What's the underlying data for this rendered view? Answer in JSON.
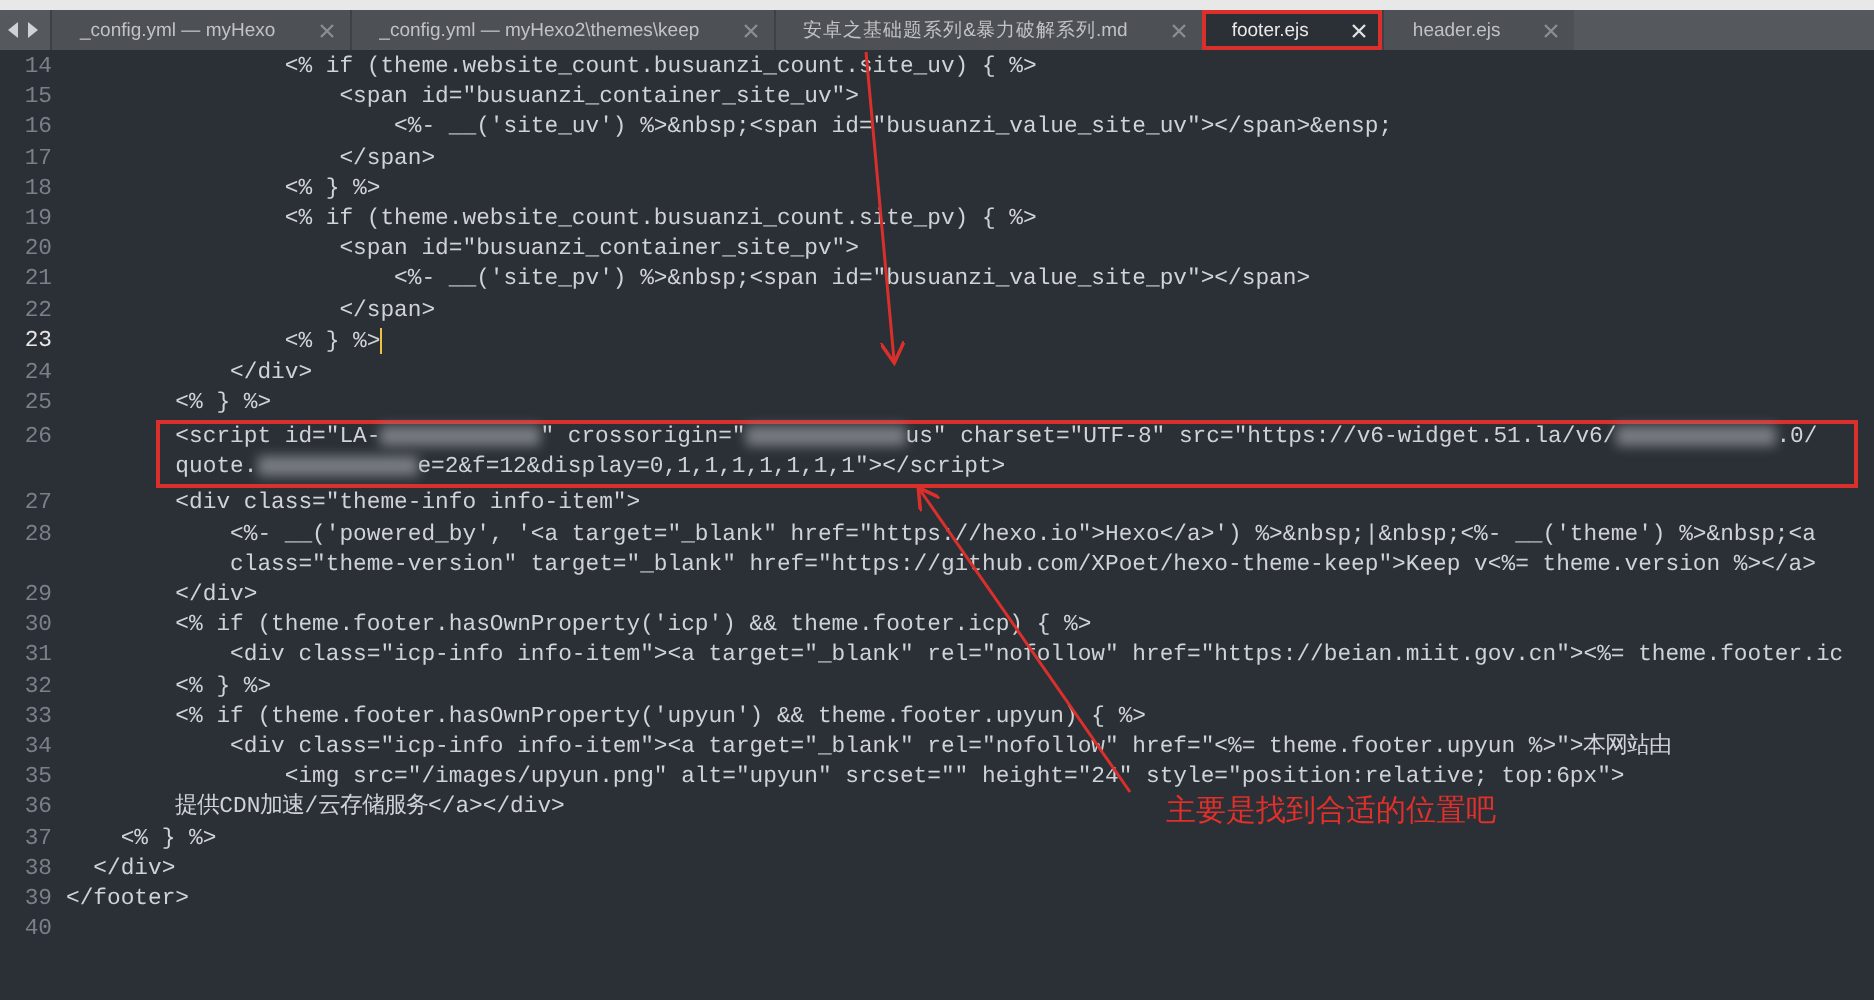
{
  "tabs": [
    {
      "label": "_config.yml — myHexo",
      "selected": false,
      "boxed": false
    },
    {
      "label": "_config.yml — myHexo2\\themes\\keep",
      "selected": false,
      "boxed": false
    },
    {
      "label": "安卓之基础题系列&暴力破解系列.md",
      "selected": false,
      "boxed": false
    },
    {
      "label": "footer.ejs",
      "selected": true,
      "boxed": true
    },
    {
      "label": "header.ejs",
      "selected": false,
      "boxed": false
    }
  ],
  "editor": {
    "lines": [
      {
        "number": "14",
        "current": false,
        "boxed": false,
        "rows": [
          "                <% if (theme.website_count.busuanzi_count.site_uv) { %>"
        ]
      },
      {
        "number": "15",
        "current": false,
        "boxed": false,
        "rows": [
          "                    <span id=\"busuanzi_container_site_uv\">"
        ]
      },
      {
        "number": "16",
        "current": false,
        "boxed": false,
        "rows": [
          "                        <%- __('site_uv') %>&nbsp;<span id=\"busuanzi_value_site_uv\"></span>&ensp;"
        ]
      },
      {
        "number": "17",
        "current": false,
        "boxed": false,
        "rows": [
          "                    </span>"
        ]
      },
      {
        "number": "18",
        "current": false,
        "boxed": false,
        "rows": [
          "                <% } %>"
        ]
      },
      {
        "number": "19",
        "current": false,
        "boxed": false,
        "rows": [
          "                <% if (theme.website_count.busuanzi_count.site_pv) { %>"
        ]
      },
      {
        "number": "20",
        "current": false,
        "boxed": false,
        "rows": [
          "                    <span id=\"busuanzi_container_site_pv\">"
        ]
      },
      {
        "number": "21",
        "current": false,
        "boxed": false,
        "rows": [
          "                        <%- __('site_pv') %>&nbsp;<span id=\"busuanzi_value_site_pv\"></span>"
        ]
      },
      {
        "number": "22",
        "current": false,
        "boxed": false,
        "rows": [
          "                    </span>"
        ]
      },
      {
        "number": "23",
        "current": true,
        "boxed": false,
        "rows": [
          "                <% } %>"
        ]
      },
      {
        "number": "24",
        "current": false,
        "boxed": false,
        "rows": [
          "            </div>"
        ]
      },
      {
        "number": "25",
        "current": false,
        "boxed": false,
        "rows": [
          "        <% } %>"
        ]
      },
      {
        "number": "26",
        "current": false,
        "boxed": true,
        "rows": [
          [
            {
              "kind": "text",
              "text": "        <script id=\"LA-"
            },
            {
              "kind": "blur"
            },
            {
              "kind": "text",
              "text": "\" crossorigin=\""
            },
            {
              "kind": "blur"
            },
            {
              "kind": "text",
              "text": "us\" charset=\"UTF-8\" src=\"https://v6-widget.51.la/v6/"
            },
            {
              "kind": "blur"
            },
            {
              "kind": "text",
              "text": ".0/"
            }
          ],
          [
            {
              "kind": "text",
              "text": "        quote."
            },
            {
              "kind": "blur"
            },
            {
              "kind": "text",
              "text": "e=2&f=12&display=0,1,1,1,1,1,1,1\"></script>"
            }
          ]
        ]
      },
      {
        "number": "27",
        "current": false,
        "boxed": false,
        "rows": [
          "        <div class=\"theme-info info-item\">"
        ]
      },
      {
        "number": "28",
        "current": false,
        "boxed": false,
        "rows": [
          "            <%- __('powered_by', '<a target=\"_blank\" href=\"https://hexo.io\">Hexo</a>') %>&nbsp;|&nbsp;<%- __('theme') %>&nbsp;<a",
          "            class=\"theme-version\" target=\"_blank\" href=\"https://github.com/XPoet/hexo-theme-keep\">Keep v<%= theme.version %></a>"
        ]
      },
      {
        "number": "29",
        "current": false,
        "boxed": false,
        "rows": [
          "        </div>"
        ]
      },
      {
        "number": "30",
        "current": false,
        "boxed": false,
        "rows": [
          "        <% if (theme.footer.hasOwnProperty('icp') && theme.footer.icp) { %>"
        ]
      },
      {
        "number": "31",
        "current": false,
        "boxed": false,
        "rows": [
          "            <div class=\"icp-info info-item\"><a target=\"_blank\" rel=\"nofollow\" href=\"https://beian.miit.gov.cn\"><%= theme.footer.ic"
        ]
      },
      {
        "number": "32",
        "current": false,
        "boxed": false,
        "rows": [
          "        <% } %>"
        ]
      },
      {
        "number": "33",
        "current": false,
        "boxed": false,
        "rows": [
          "        <% if (theme.footer.hasOwnProperty('upyun') && theme.footer.upyun) { %>"
        ]
      },
      {
        "number": "34",
        "current": false,
        "boxed": false,
        "rows": [
          "            <div class=\"icp-info info-item\"><a target=\"_blank\" rel=\"nofollow\" href=\"<%= theme.footer.upyun %>\">本网站由"
        ]
      },
      {
        "number": "35",
        "current": false,
        "boxed": false,
        "rows": [
          "                <img src=\"/images/upyun.png\" alt=\"upyun\" srcset=\"\" height=\"24\" style=\"position:relative; top:6px\">"
        ]
      },
      {
        "number": "36",
        "current": false,
        "boxed": false,
        "rows": [
          "        提供CDN加速/云存储服务</a></div>"
        ]
      },
      {
        "number": "37",
        "current": false,
        "boxed": false,
        "rows": [
          "    <% } %>"
        ]
      },
      {
        "number": "38",
        "current": false,
        "boxed": false,
        "rows": [
          "  </div>"
        ]
      },
      {
        "number": "39",
        "current": false,
        "boxed": false,
        "rows": [
          "</footer>"
        ]
      },
      {
        "number": "40",
        "current": false,
        "boxed": false,
        "rows": [
          ""
        ]
      }
    ]
  },
  "annotation": {
    "note": "主要是找到合适的位置吧"
  }
}
